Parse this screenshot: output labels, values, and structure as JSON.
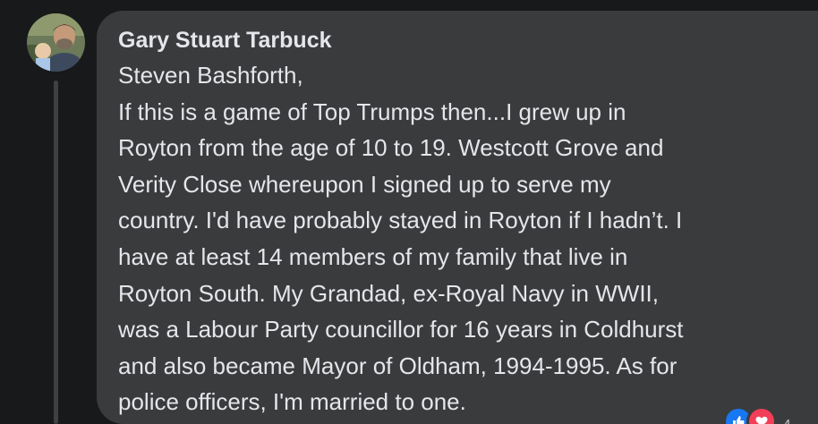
{
  "comment": {
    "author": "Gary Stuart Tarbuck",
    "lines": [
      "Steven Bashforth,",
      "If this is a game of Top Trumps then...I grew up in",
      "Royton from the age of 10 to 19. Westcott Grove and",
      "Verity Close whereupon I signed up to serve my",
      "country. I'd have probably stayed in Royton if I hadn’t. I",
      "have at least 14 members of my family that live in",
      "Royton South. My Grandad, ex-Royal Navy in WWII,",
      "was a Labour Party councillor for 16 years in Coldhurst",
      "and also became Mayor of Oldham, 1994-1995. As for",
      "police officers, I'm married to one."
    ],
    "reactions": {
      "icons": [
        "like-icon",
        "love-icon"
      ],
      "count": "4"
    }
  },
  "colors": {
    "background": "#18191a",
    "bubble": "#3a3b3c",
    "text": "#e4e6eb",
    "like": "#1877f2",
    "love": "#f33e58"
  }
}
